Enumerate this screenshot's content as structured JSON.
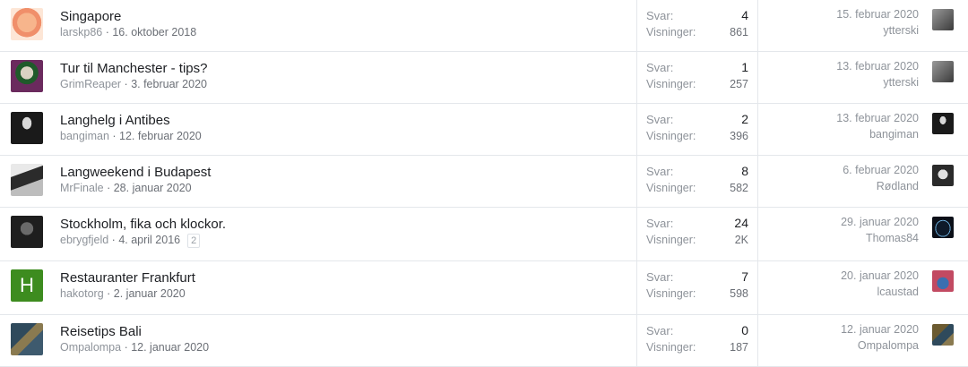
{
  "labels": {
    "replies": "Svar:",
    "views": "Visninger:"
  },
  "threads": [
    {
      "title": "Singapore",
      "author": "larskp86",
      "date": "16. oktober 2018",
      "pages": "",
      "replies": "4",
      "views": "861",
      "last_date": "15. februar 2020",
      "last_user": "ytterski",
      "avatar_color": "#f4a980",
      "last_avatar_color": "#6f6f6f"
    },
    {
      "title": "Tur til Manchester - tips?",
      "author": "GrimReaper",
      "date": "3. februar 2020",
      "pages": "",
      "replies": "1",
      "views": "257",
      "last_date": "13. februar 2020",
      "last_user": "ytterski",
      "avatar_color": "#6b2a5e",
      "last_avatar_color": "#6f6f6f"
    },
    {
      "title": "Langhelg i Antibes",
      "author": "bangiman",
      "date": "12. februar 2020",
      "pages": "",
      "replies": "2",
      "views": "396",
      "last_date": "13. februar 2020",
      "last_user": "bangiman",
      "avatar_color": "#2a2a2a",
      "last_avatar_color": "#2a2a2a"
    },
    {
      "title": "Langweekend i Budapest",
      "author": "MrFinale",
      "date": "28. januar 2020",
      "pages": "",
      "replies": "8",
      "views": "582",
      "last_date": "6. februar 2020",
      "last_user": "Rødland",
      "avatar_color": "#3b3b3b",
      "last_avatar_color": "#4a4a4a"
    },
    {
      "title": "Stockholm, fika och klockor.",
      "author": "ebrygfjeld",
      "date": "4. april 2016",
      "pages": "2",
      "replies": "24",
      "views": "2K",
      "last_date": "29. januar 2020",
      "last_user": "Thomas84",
      "avatar_color": "#202020",
      "last_avatar_color": "#0e1a2a"
    },
    {
      "title": "Restauranter Frankfurt",
      "author": "hakotorg",
      "date": "2. januar 2020",
      "pages": "",
      "replies": "7",
      "views": "598",
      "last_date": "20. januar 2020",
      "last_user": "lcaustad",
      "avatar_color": "#3d8c1f",
      "avatar_letter": "H",
      "last_avatar_color": "#c24a62"
    },
    {
      "title": "Reisetips Bali",
      "author": "Ompalompa",
      "date": "12. januar 2020",
      "pages": "",
      "replies": "0",
      "views": "187",
      "last_date": "12. januar 2020",
      "last_user": "Ompalompa",
      "avatar_color": "#3e5a6e",
      "last_avatar_color": "#5a4a2a"
    }
  ]
}
